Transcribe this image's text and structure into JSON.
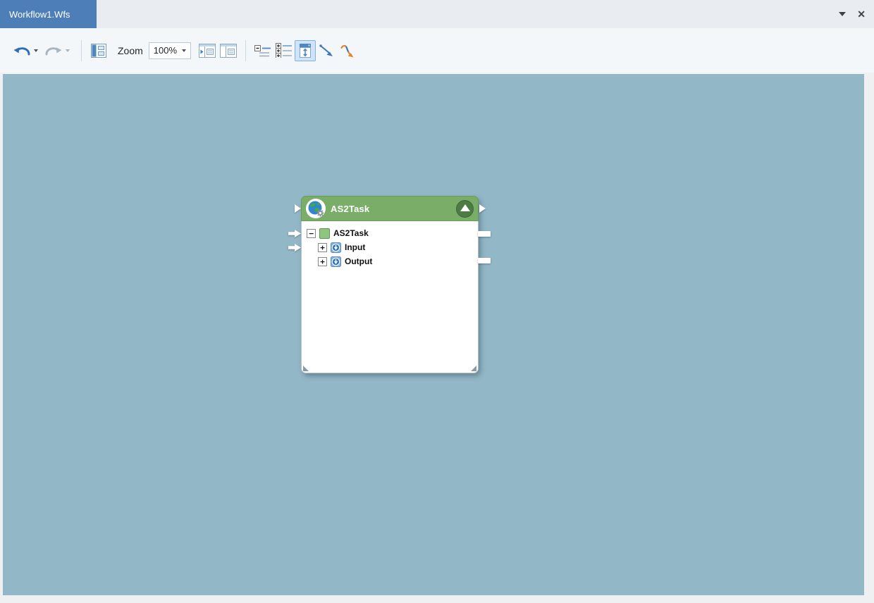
{
  "tab_bar": {
    "active_tab": "Workflow1.Wfs"
  },
  "toolbar": {
    "zoom_label": "Zoom",
    "zoom_value": "100%"
  },
  "node": {
    "title": "AS2Task",
    "tree": [
      {
        "expander": "−",
        "label": "AS2Task",
        "icon": "task-square-icon"
      },
      {
        "expander": "+",
        "label": "Input",
        "icon": "parameter-icon"
      },
      {
        "expander": "+",
        "label": "Output",
        "icon": "parameter-icon"
      }
    ]
  },
  "icons": {
    "tab_dropdown": "▾",
    "tab_close": "✕",
    "undo": "curved-arrow-left",
    "redo": "curved-arrow-right",
    "node_badge": "globe-gear",
    "node_collapse": "triangle-up"
  },
  "colors": {
    "canvas_background": "#92b7c6",
    "active_tab": "#4d7eb7",
    "node_header": "#79ad68",
    "node_collapse_button": "#4c7b44",
    "tree_green_icon": "#8ec57f",
    "tree_blue_icon": "#82b1e0",
    "toolbar_active_button": "#cfe4f8"
  }
}
